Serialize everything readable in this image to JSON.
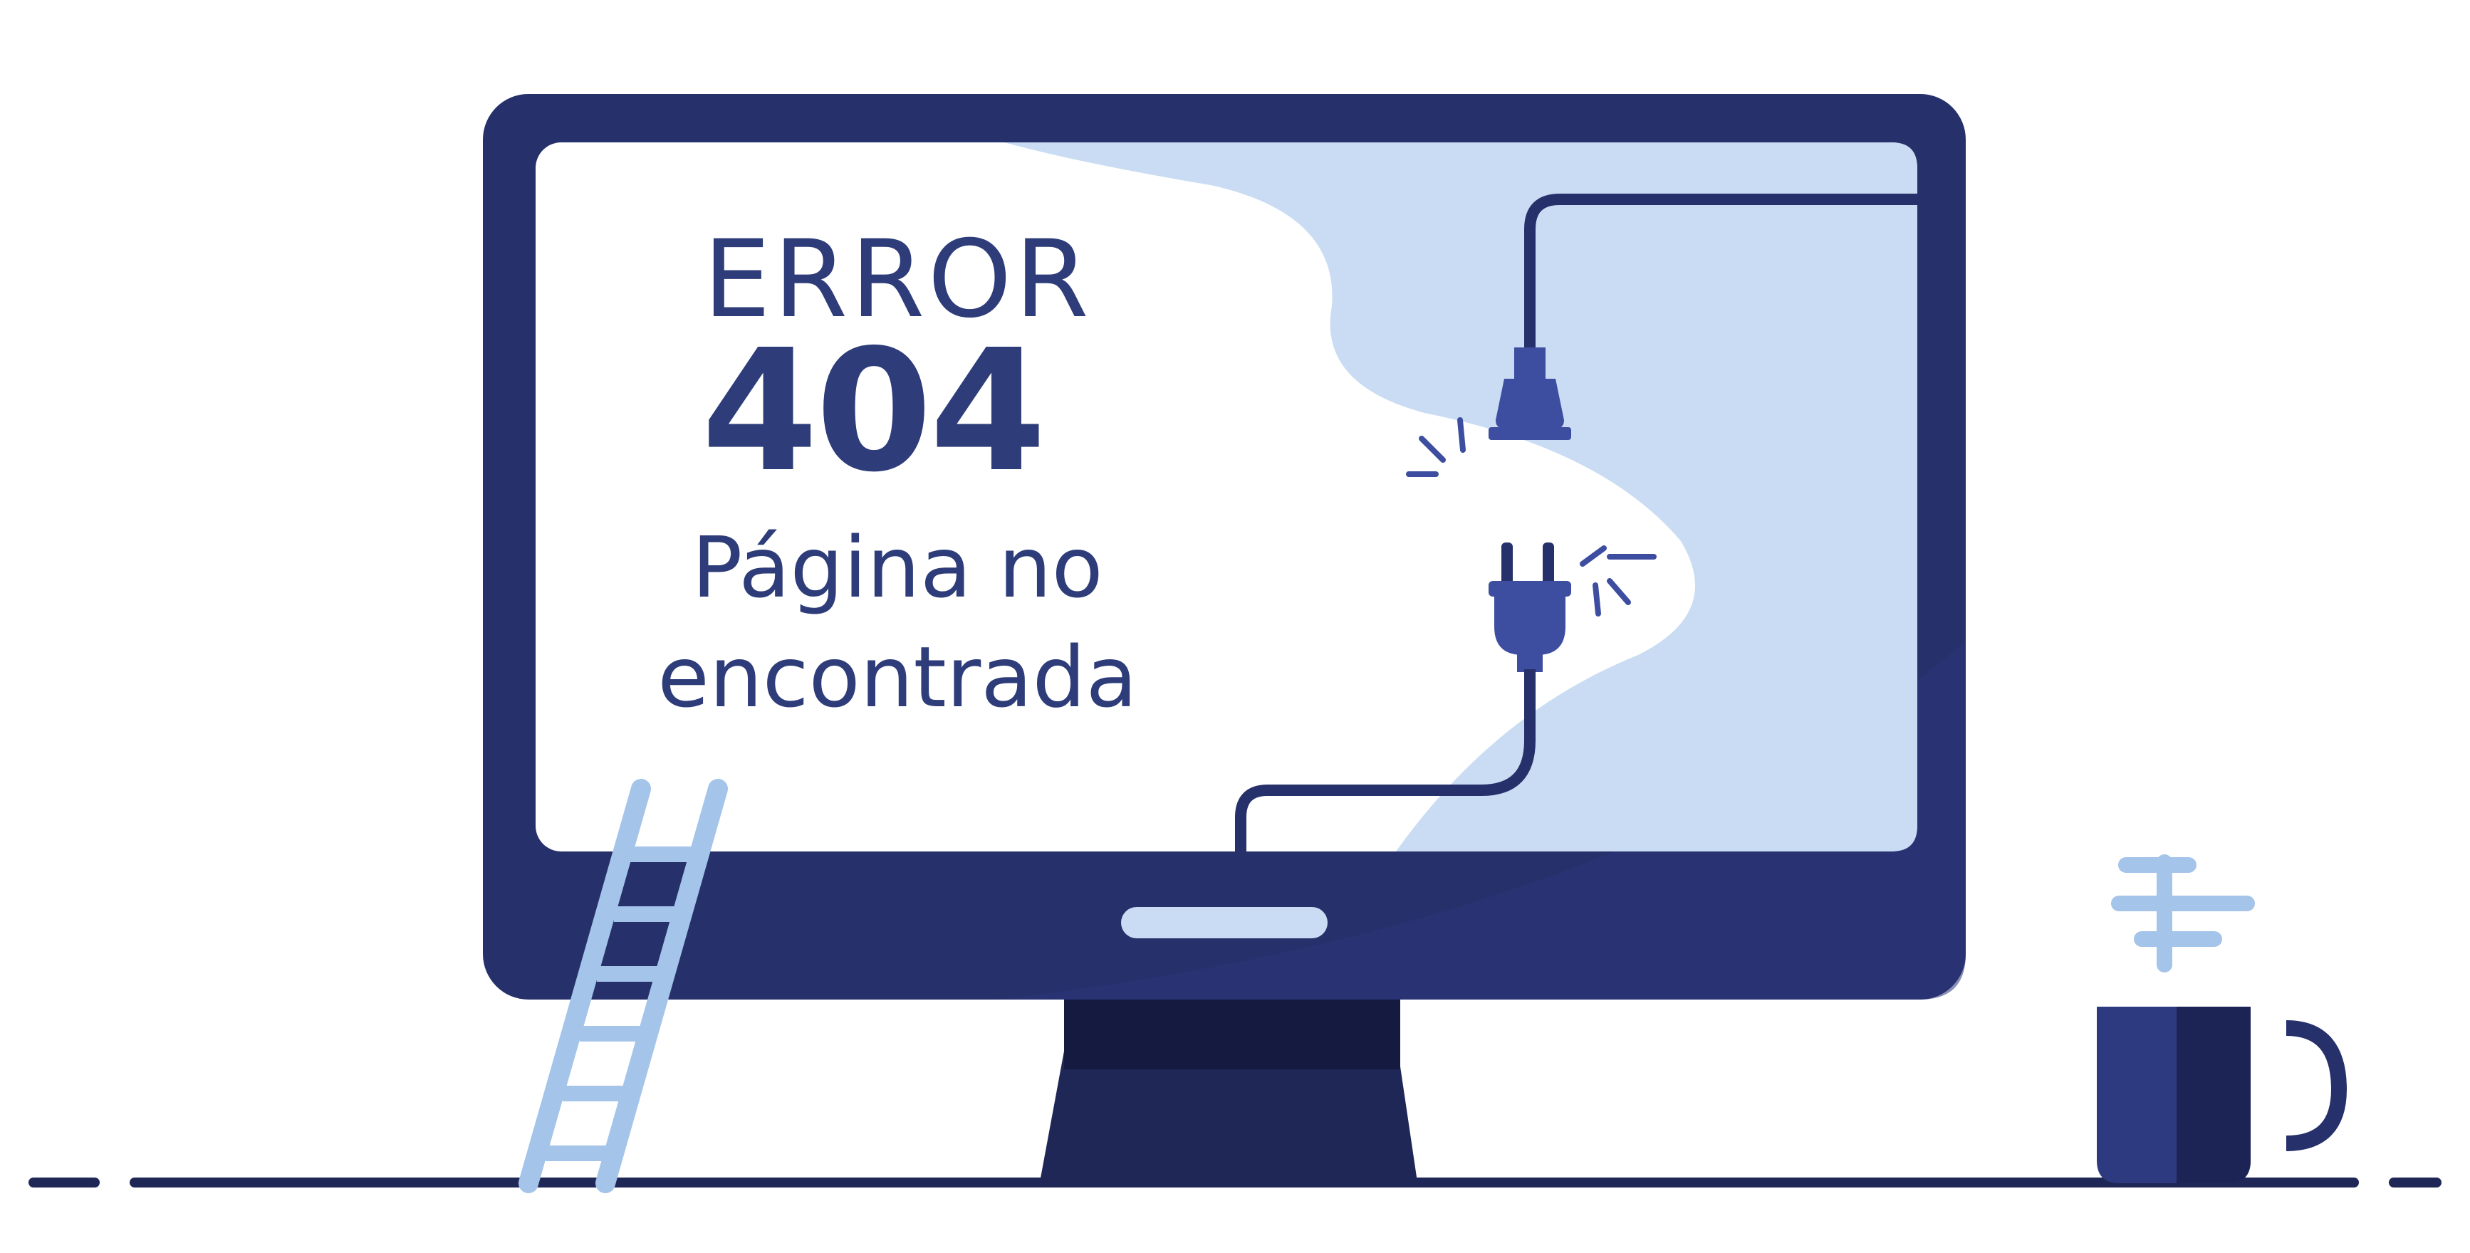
{
  "error": {
    "word": "ERROR",
    "code": "404",
    "message_line1": "Página no",
    "message_line2": "encontrada"
  },
  "illustration": {
    "icons": [
      "monitor-icon",
      "power-plug-icon",
      "power-socket-icon",
      "ladder-icon",
      "coffee-mug-icon",
      "steam-icon"
    ],
    "colors": {
      "frame": "#26306a",
      "frame_light": "#313d85",
      "screen": "#ffffff",
      "screen_blob": "#c9dcf3",
      "plug": "#3d4ea0",
      "cable": "#26306a",
      "ladder": "#a4c4ea",
      "steam": "#a4c4ea",
      "stand": "#1f2757",
      "floor": "#1f2757",
      "text": "#2e3d7a"
    }
  }
}
